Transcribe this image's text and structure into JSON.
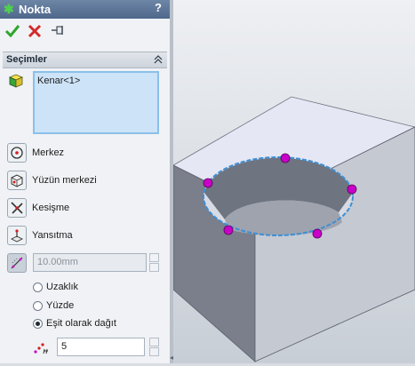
{
  "panel": {
    "title": "Nokta",
    "help_label": "?",
    "actions": {
      "ok_icon": "checkmark-icon",
      "cancel_icon": "cross-icon",
      "pin_icon": "pushpin-icon"
    },
    "selections_group": {
      "title": "Seçimler",
      "list_items": [
        "Kenar<1>"
      ]
    },
    "options": [
      {
        "label": "Merkez",
        "icon": "arc-center-icon"
      },
      {
        "label": "Yüzün merkezi",
        "icon": "face-center-icon"
      },
      {
        "label": "Kesişme",
        "icon": "intersection-icon"
      },
      {
        "label": "Yansıtma",
        "icon": "projection-icon"
      }
    ],
    "distance_field": {
      "value": "10.00mm",
      "disabled": true
    },
    "radios": [
      {
        "label": "Uzaklık",
        "selected": false
      },
      {
        "label": "Yüzde",
        "selected": false
      },
      {
        "label": "Eşit olarak dağıt",
        "selected": true
      }
    ],
    "count_field": {
      "value": "5"
    }
  },
  "colors": {
    "titlebar": "#5a7396",
    "selection_box": "#cde3f7",
    "point_marker": "#c800c8",
    "edge_highlight": "#3d8fd6"
  }
}
